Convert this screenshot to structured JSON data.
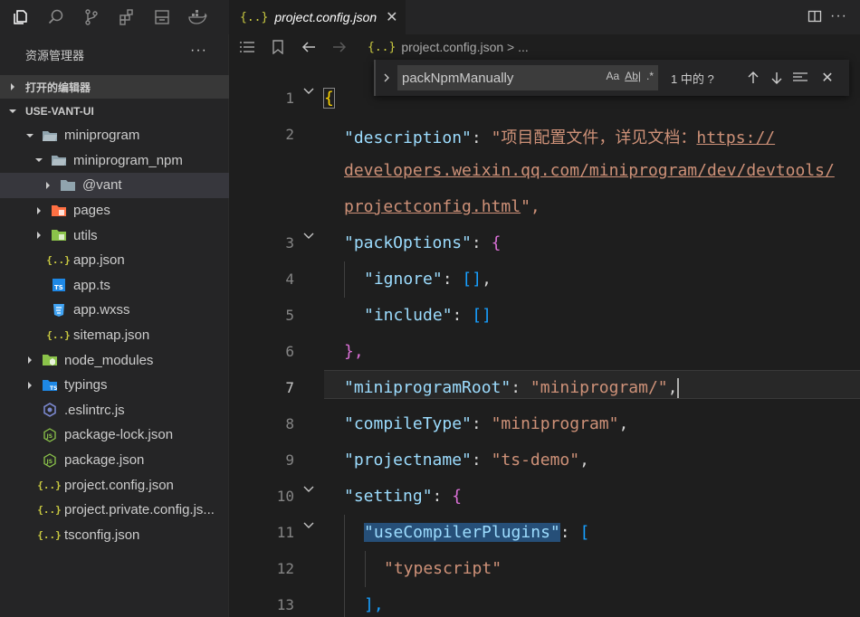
{
  "explorer": {
    "title": "资源管理器",
    "more": "···",
    "open_editors_label": "打开的编辑器",
    "workspace_label": "USE-VANT-UI",
    "tree": [
      {
        "label": "miniprogram",
        "depth": 1,
        "kind": "folder-open",
        "twisty": "down"
      },
      {
        "label": "miniprogram_npm",
        "depth": 2,
        "kind": "folder-open",
        "twisty": "down"
      },
      {
        "label": "@vant",
        "depth": 3,
        "kind": "folder",
        "twisty": "right",
        "selected": true
      },
      {
        "label": "pages",
        "depth": 2,
        "kind": "folder-pages",
        "twisty": "right"
      },
      {
        "label": "utils",
        "depth": 2,
        "kind": "folder-utils",
        "twisty": "right"
      },
      {
        "label": "app.json",
        "depth": 2,
        "kind": "json"
      },
      {
        "label": "app.ts",
        "depth": 2,
        "kind": "ts"
      },
      {
        "label": "app.wxss",
        "depth": 2,
        "kind": "css"
      },
      {
        "label": "sitemap.json",
        "depth": 2,
        "kind": "json"
      },
      {
        "label": "node_modules",
        "depth": 1,
        "kind": "folder-node",
        "twisty": "right"
      },
      {
        "label": "typings",
        "depth": 1,
        "kind": "folder-ts",
        "twisty": "right"
      },
      {
        "label": ".eslintrc.js",
        "depth": 1,
        "kind": "eslint"
      },
      {
        "label": "package-lock.json",
        "depth": 1,
        "kind": "npm"
      },
      {
        "label": "package.json",
        "depth": 1,
        "kind": "npm"
      },
      {
        "label": "project.config.json",
        "depth": 1,
        "kind": "json"
      },
      {
        "label": "project.private.config.js...",
        "depth": 1,
        "kind": "json"
      },
      {
        "label": "tsconfig.json",
        "depth": 1,
        "kind": "json"
      }
    ]
  },
  "tab": {
    "icon_text": "{..}",
    "name": "project.config.json",
    "close": "✕"
  },
  "breadcrumb": {
    "icon_text": "{..}",
    "text": "project.config.json > ..."
  },
  "find": {
    "query": "packNpmManually",
    "opt_case": "Aa",
    "opt_word": "Ab|",
    "opt_regex": ".*",
    "count": "1 中的 ?",
    "prev": "↑",
    "next": "↓",
    "close": "✕"
  },
  "editor": {
    "current_line": 7,
    "line_numbers": [
      "1",
      "2",
      "",
      "",
      "3",
      "4",
      "5",
      "6",
      "7",
      "8",
      "9",
      "10",
      "11",
      "12",
      "13"
    ],
    "code": {
      "l1_open": "{",
      "l2_key": "\"description\"",
      "l2_val1": "\"项目配置文件，详见文档：",
      "l2_url1": "https://",
      "l2_url2": "developers.weixin.qq.com/miniprogram/dev/devtools/",
      "l2_url3": "projectconfig.html",
      "l2_end": "\",",
      "l3_key": "\"packOptions\"",
      "l4_key": "\"ignore\"",
      "l5_key": "\"include\"",
      "l6_close": "},",
      "l7_key": "\"miniprogramRoot\"",
      "l7_val": "\"miniprogram/\"",
      "l8_key": "\"compileType\"",
      "l8_val": "\"miniprogram\"",
      "l9_key": "\"projectname\"",
      "l9_val": "\"ts-demo\"",
      "l10_key": "\"setting\"",
      "l11_key": "\"useCompilerPlugins\"",
      "l12_val": "\"typescript\"",
      "l13_close": "],"
    }
  }
}
